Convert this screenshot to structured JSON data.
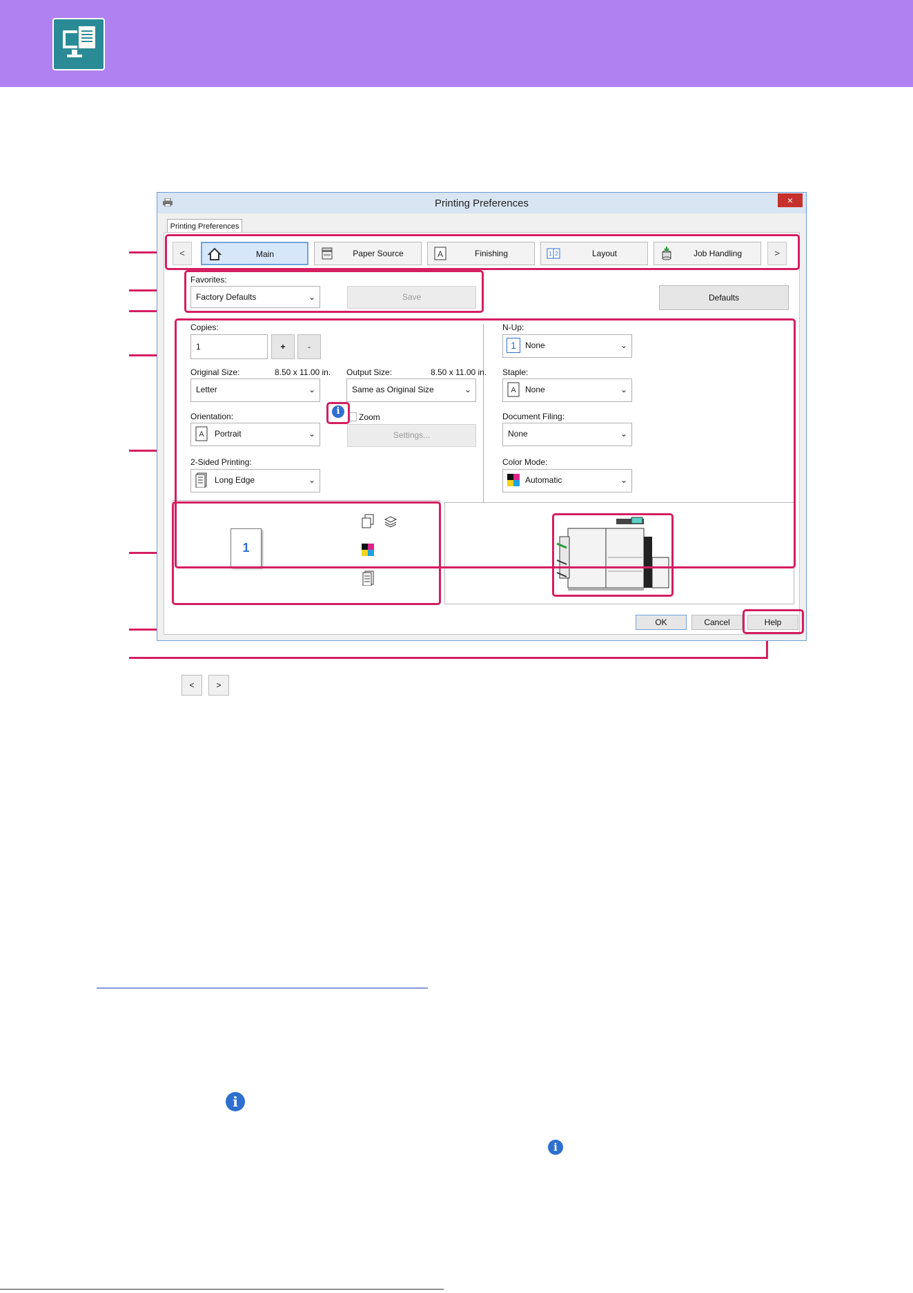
{
  "colors": {
    "header": "#b081f1",
    "accent": "#d51e61",
    "info": "#2e6fd0"
  },
  "window": {
    "title": "Printing Preferences",
    "close": "×",
    "outer_tab": "Printing Preferences"
  },
  "tabs": {
    "prev": "<",
    "next": ">",
    "items": [
      {
        "label": "Main",
        "icon": "home-icon"
      },
      {
        "label": "Paper Source",
        "icon": "paper-source-icon"
      },
      {
        "label": "Finishing",
        "icon": "finishing-icon"
      },
      {
        "label": "Layout",
        "icon": "layout-icon"
      },
      {
        "label": "Job Handling",
        "icon": "job-handling-icon"
      }
    ]
  },
  "favorites": {
    "label": "Favorites:",
    "value": "Factory Defaults",
    "save": "Save"
  },
  "defaults_button": "Defaults",
  "copies": {
    "label": "Copies:",
    "value": "1",
    "plus": "+",
    "minus": "-"
  },
  "original_size": {
    "label": "Original Size:",
    "dims": "8.50 x 11.00 in.",
    "value": "Letter"
  },
  "output_size": {
    "label": "Output Size:",
    "dims": "8.50 x 11.00 in.",
    "value": "Same as Original Size"
  },
  "orientation": {
    "label": "Orientation:",
    "value": "Portrait"
  },
  "zoom": {
    "label": "Zoom",
    "checked": false,
    "settings": "Settings..."
  },
  "two_sided": {
    "label": "2-Sided Printing:",
    "value": "Long Edge"
  },
  "nup": {
    "label": "N-Up:",
    "value": "None",
    "icon_text": "1"
  },
  "staple": {
    "label": "Staple:",
    "value": "None"
  },
  "document_filing": {
    "label": "Document Filing:",
    "value": "None"
  },
  "color_mode": {
    "label": "Color Mode:",
    "value": "Automatic"
  },
  "preview": {
    "page_number": "1"
  },
  "buttons": {
    "ok": "OK",
    "cancel": "Cancel",
    "help": "Help"
  },
  "below": {
    "prev": "<",
    "next": ">"
  },
  "dropdown_arrow": "⌄",
  "info_glyph": "i",
  "orientation_glyph": "A"
}
